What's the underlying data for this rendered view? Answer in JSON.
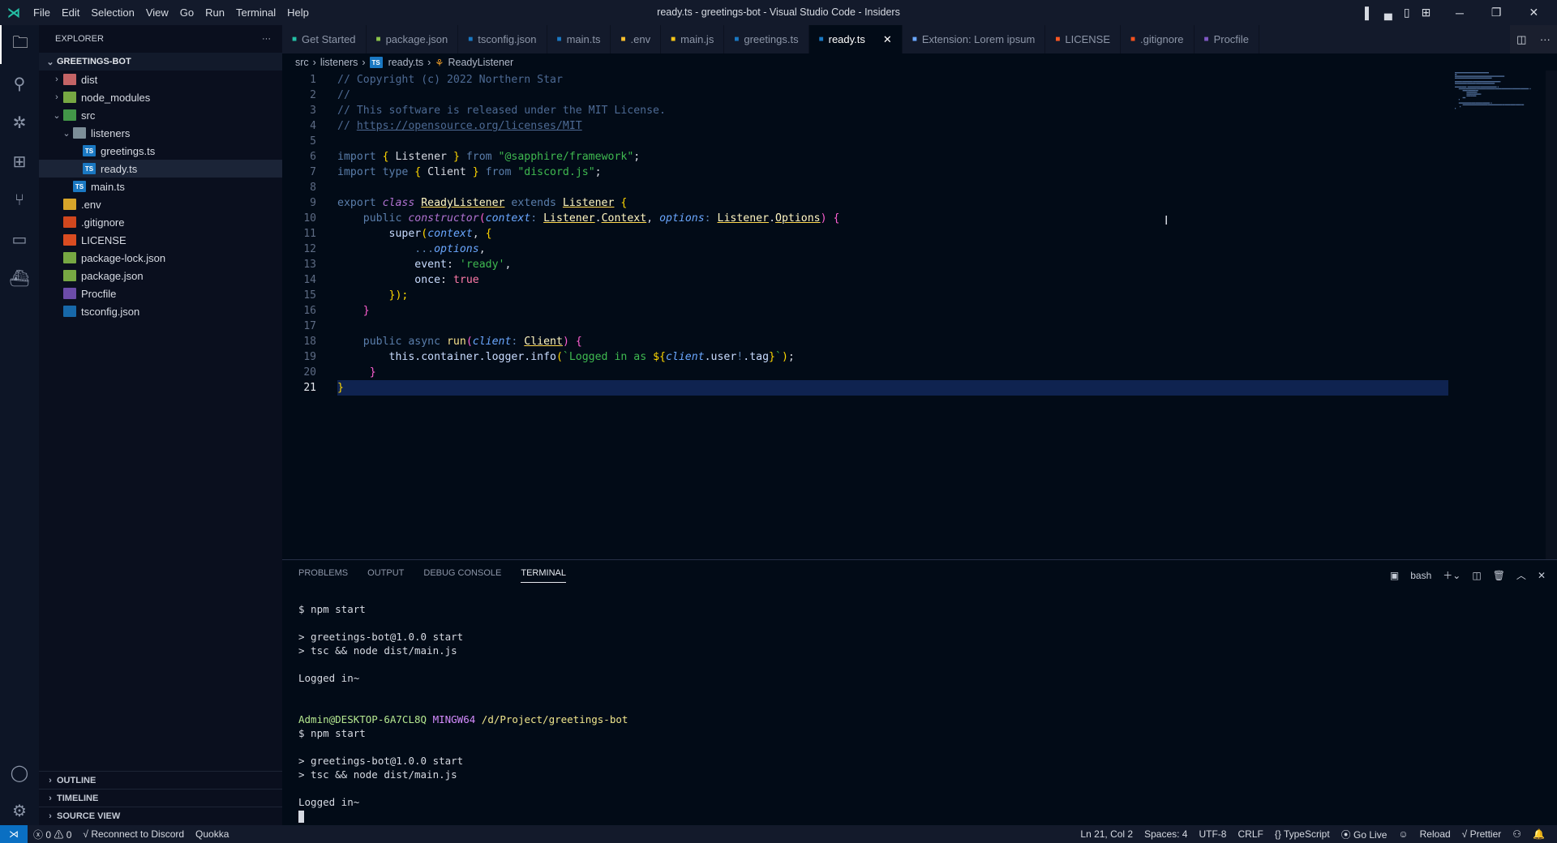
{
  "titlebar": {
    "menu": [
      "File",
      "Edit",
      "Selection",
      "View",
      "Go",
      "Run",
      "Terminal",
      "Help"
    ],
    "title": "ready.ts - greetings-bot - Visual Studio Code - Insiders"
  },
  "activity": [
    "explorer-icon",
    "search-icon",
    "debug-icon",
    "extensions-icon",
    "source-control-icon",
    "remote-explorer-icon",
    "docker-icon",
    "account-icon",
    "manage-icon"
  ],
  "sidebar": {
    "title": "EXPLORER",
    "more": "···",
    "root": "GREETINGS-BOT",
    "items": [
      {
        "label": "dist",
        "depth": 0,
        "chev": "›",
        "icon": "folder-dist-icon",
        "color": "#e57373"
      },
      {
        "label": "node_modules",
        "depth": 0,
        "chev": "›",
        "icon": "folder-node-icon",
        "color": "#8bc34a"
      },
      {
        "label": "src",
        "depth": 0,
        "chev": "⌄",
        "icon": "folder-src-icon",
        "color": "#4caf50"
      },
      {
        "label": "listeners",
        "depth": 1,
        "chev": "⌄",
        "icon": "folder-icon",
        "color": "#90a4ae"
      },
      {
        "label": "greetings.ts",
        "depth": 2,
        "chev": "",
        "icon": "typescript-icon",
        "color": "#1a78c2"
      },
      {
        "label": "ready.ts",
        "depth": 2,
        "chev": "",
        "icon": "typescript-icon",
        "color": "#1a78c2",
        "selected": true
      },
      {
        "label": "main.ts",
        "depth": 1,
        "chev": "",
        "icon": "typescript-icon",
        "color": "#1a78c2"
      },
      {
        "label": ".env",
        "depth": 0,
        "chev": "",
        "icon": "env-icon",
        "color": "#fbc02d"
      },
      {
        "label": ".gitignore",
        "depth": 0,
        "chev": "",
        "icon": "git-icon",
        "color": "#f4511e"
      },
      {
        "label": "LICENSE",
        "depth": 0,
        "chev": "",
        "icon": "license-icon",
        "color": "#ff5722"
      },
      {
        "label": "package-lock.json",
        "depth": 0,
        "chev": "",
        "icon": "nodejs-icon",
        "color": "#8bc34a"
      },
      {
        "label": "package.json",
        "depth": 0,
        "chev": "",
        "icon": "nodejs-icon",
        "color": "#8bc34a"
      },
      {
        "label": "Procfile",
        "depth": 0,
        "chev": "",
        "icon": "heroku-icon",
        "color": "#7e57c2"
      },
      {
        "label": "tsconfig.json",
        "depth": 0,
        "chev": "",
        "icon": "tsconfig-icon",
        "color": "#1a78c2"
      }
    ],
    "sections": [
      "OUTLINE",
      "TIMELINE",
      "SOURCE VIEW"
    ]
  },
  "tabs": [
    {
      "label": "Get Started",
      "icon": "vscode-icon",
      "color": "#24bfa5"
    },
    {
      "label": "package.json",
      "icon": "nodejs-icon",
      "color": "#8bc34a"
    },
    {
      "label": "tsconfig.json",
      "icon": "tsconfig-icon",
      "color": "#1a78c2"
    },
    {
      "label": "main.ts",
      "icon": "typescript-icon",
      "color": "#1a78c2"
    },
    {
      "label": ".env",
      "icon": "env-icon",
      "color": "#fbc02d"
    },
    {
      "label": "main.js",
      "icon": "javascript-icon",
      "color": "#f5c518"
    },
    {
      "label": "greetings.ts",
      "icon": "typescript-icon",
      "color": "#1a78c2"
    },
    {
      "label": "ready.ts",
      "icon": "typescript-icon",
      "color": "#1a78c2",
      "active": true,
      "close": "✕"
    },
    {
      "label": "Extension: Lorem ipsum",
      "icon": "file-icon",
      "color": "#6aa7ff"
    },
    {
      "label": "LICENSE",
      "icon": "license-icon",
      "color": "#ff5722"
    },
    {
      "label": ".gitignore",
      "icon": "git-icon",
      "color": "#f4511e"
    },
    {
      "label": "Procfile",
      "icon": "heroku-icon",
      "color": "#7e57c2"
    }
  ],
  "breadcrumb": [
    "src",
    "listeners",
    "ready.ts",
    "ReadyListener"
  ],
  "editor": {
    "current_line": 21,
    "lines": [
      [
        [
          "c",
          "// Copyright (c) 2022 Northern Star"
        ]
      ],
      [
        [
          "c",
          "//"
        ]
      ],
      [
        [
          "c",
          "// This software is released under the MIT License."
        ]
      ],
      [
        [
          "c",
          "// "
        ],
        [
          "cu",
          "https://opensource.org/licenses/MIT"
        ]
      ],
      [],
      [
        [
          "k",
          "import "
        ],
        [
          "b1",
          "{"
        ],
        [
          "pl",
          " Listener "
        ],
        [
          "b1",
          "}"
        ],
        [
          "k",
          " from "
        ],
        [
          "s",
          "\"@sapphire/framework\""
        ],
        [
          "pl",
          ";"
        ]
      ],
      [
        [
          "k",
          "import type "
        ],
        [
          "b1",
          "{"
        ],
        [
          "pl",
          " Client "
        ],
        [
          "b1",
          "}"
        ],
        [
          "k",
          " from "
        ],
        [
          "s",
          "\"discord.js\""
        ],
        [
          "pl",
          ";"
        ]
      ],
      [],
      [
        [
          "k",
          "export "
        ],
        [
          "ctor",
          "class"
        ],
        [
          "pl",
          " "
        ],
        [
          "t",
          "ReadyListener"
        ],
        [
          "k",
          " extends "
        ],
        [
          "t",
          "Listener"
        ],
        [
          "pl",
          " "
        ],
        [
          "b1",
          "{"
        ]
      ],
      [
        [
          "pl",
          "    "
        ],
        [
          "k",
          "public "
        ],
        [
          "ctor",
          "constructor"
        ],
        [
          "b2",
          "("
        ],
        [
          "p",
          "context"
        ],
        [
          "k",
          ": "
        ],
        [
          "t",
          "Listener"
        ],
        [
          "pl",
          "."
        ],
        [
          "t",
          "Context"
        ],
        [
          "pl",
          ", "
        ],
        [
          "p",
          "options"
        ],
        [
          "k",
          ": "
        ],
        [
          "t",
          "Listener"
        ],
        [
          "pl",
          "."
        ],
        [
          "t",
          "Options"
        ],
        [
          "b2",
          ")"
        ],
        [
          "pl",
          " "
        ],
        [
          "b2",
          "{"
        ]
      ],
      [
        [
          "pl",
          "        "
        ],
        [
          "id",
          "super"
        ],
        [
          "b1",
          "("
        ],
        [
          "p",
          "context"
        ],
        [
          "pl",
          ", "
        ],
        [
          "b1",
          "{"
        ]
      ],
      [
        [
          "pl",
          "            "
        ],
        [
          "k",
          "..."
        ],
        [
          "p",
          "options"
        ],
        [
          "pl",
          ","
        ]
      ],
      [
        [
          "pl",
          "            "
        ],
        [
          "id",
          "event"
        ],
        [
          "pl",
          ": "
        ],
        [
          "s",
          "'ready'"
        ],
        [
          "pl",
          ","
        ]
      ],
      [
        [
          "pl",
          "            "
        ],
        [
          "id",
          "once"
        ],
        [
          "pl",
          ": "
        ],
        [
          "tr",
          "true"
        ]
      ],
      [
        [
          "pl",
          "        "
        ],
        [
          "b1",
          "});"
        ]
      ],
      [
        [
          "pl",
          "    "
        ],
        [
          "b2",
          "}"
        ]
      ],
      [],
      [
        [
          "pl",
          "    "
        ],
        [
          "k",
          "public async "
        ],
        [
          "fn",
          "run"
        ],
        [
          "b2",
          "("
        ],
        [
          "p",
          "client"
        ],
        [
          "k",
          ": "
        ],
        [
          "t",
          "Client"
        ],
        [
          "b2",
          ")"
        ],
        [
          "pl",
          " "
        ],
        [
          "b2",
          "{"
        ]
      ],
      [
        [
          "pl",
          "        "
        ],
        [
          "id",
          "this.container.logger.info"
        ],
        [
          "b1",
          "("
        ],
        [
          "s",
          "`Logged in as "
        ],
        [
          "b1",
          "${"
        ],
        [
          "p",
          "client"
        ],
        [
          "id",
          ".user"
        ],
        [
          "k",
          "!"
        ],
        [
          "id",
          ".tag"
        ],
        [
          "b1",
          "}"
        ],
        [
          "s",
          "`"
        ],
        [
          "b1",
          ")"
        ],
        [
          "pl",
          ";"
        ]
      ],
      [
        [
          "pl",
          "     "
        ],
        [
          "b2",
          "}"
        ]
      ],
      [
        [
          "b1",
          "}"
        ]
      ]
    ]
  },
  "panel": {
    "tabs": [
      "PROBLEMS",
      "OUTPUT",
      "DEBUG CONSOLE",
      "TERMINAL"
    ],
    "active_tab": "TERMINAL",
    "shell": "bash",
    "terminal": [
      [
        [
          "",
          "$ npm start"
        ]
      ],
      [],
      [
        [
          "",
          "> greetings-bot@1.0.0 start"
        ]
      ],
      [
        [
          "",
          "> tsc && node dist/main.js"
        ]
      ],
      [],
      [
        [
          "",
          "Logged in~"
        ]
      ],
      [],
      [],
      [
        [
          "tg",
          "Admin@DESKTOP-6A7CL8Q"
        ],
        [
          "",
          " "
        ],
        [
          "tm",
          "MINGW64"
        ],
        [
          "",
          " "
        ],
        [
          "ty",
          "/d/Project/greetings-bot"
        ]
      ],
      [
        [
          "",
          "$ npm start"
        ]
      ],
      [],
      [
        [
          "",
          "> greetings-bot@1.0.0 start"
        ]
      ],
      [
        [
          "",
          "> tsc && node dist/main.js"
        ]
      ],
      [],
      [
        [
          "",
          "Logged in~"
        ]
      ]
    ]
  },
  "status": {
    "errors": "0",
    "warnings": "0",
    "reconnect": "Reconnect to Discord",
    "quokka": "Quokka",
    "position": "Ln 21, Col 2",
    "spaces": "Spaces: 4",
    "encoding": "UTF-8",
    "eol": "CRLF",
    "language": "TypeScript",
    "golive": "Go Live",
    "reload": "Reload",
    "prettier": "Prettier"
  }
}
